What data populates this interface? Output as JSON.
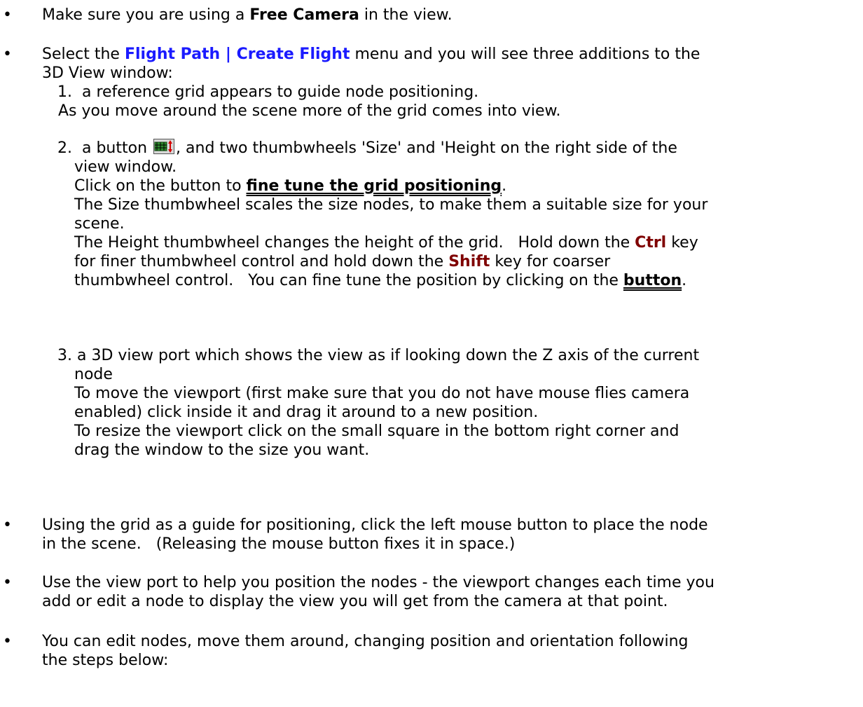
{
  "bullet_glyph": "•",
  "b1": {
    "pre": "Make sure you are using a ",
    "strong": "Free Camera",
    "post": " in the view."
  },
  "b2": {
    "pre": "Select the ",
    "menu_link": "Flight Path | Create Flight",
    "post_l1": " menu and you will see three additions to the",
    "line2": "3D View window:"
  },
  "s1": {
    "num": "1.",
    "l1": "  a reference grid appears to guide node positioning.",
    "l2": "As you move around the scene more of the grid comes into view."
  },
  "s2": {
    "num": "2.",
    "l1_pre": "  a button ",
    "l1_post": ", and two thumbwheels 'Size' and 'Height on the right side of the",
    "l2": "view window.",
    "l3_pre": "Click on the button to ",
    "l3_link": "fine tune the grid positioning",
    "l3_post": ".",
    "l4": "The Size thumbwheel scales the size nodes, to make them a suitable size for your",
    "l5": "scene.",
    "l6_pre": "The Height thumbwheel changes the height of the grid.   Hold down the ",
    "l6_key": "Ctrl",
    "l6_post": " key",
    "l7_pre": "for finer thumbwheel control and hold down the ",
    "l7_key": "Shift",
    "l7_post": " key for coarser",
    "l8_pre": "thumbwheel control.   You can fine tune the position by clicking on the ",
    "l8_link": "button",
    "l8_post": "."
  },
  "s3": {
    "l1": "3. a 3D view port which shows the view as if looking down the Z axis of the current",
    "l2": "node",
    "l3": "To move the viewport (first make sure that you do not have mouse flies camera",
    "l4": "enabled) click inside it and drag it around to a new position.",
    "l5": "To resize the viewport click on the small square in the bottom right corner and",
    "l6": "drag the window to the size you want."
  },
  "b3": {
    "l1": "Using the grid as a guide for positioning, click the left mouse button to place the node",
    "l2": "in the scene.   (Releasing the mouse button fixes it in space.)"
  },
  "b4": {
    "l1": "Use the view port to help you position the nodes - the viewport changes each time you",
    "l2": "add or edit a node to display the view you will get from the camera at that point."
  },
  "b5": {
    "l1": "You can edit nodes, move them around, changing position and orientation following",
    "l2": "the steps below:"
  },
  "colors": {
    "link_blue": "#1a1aff",
    "key_red": "#7f0000"
  }
}
